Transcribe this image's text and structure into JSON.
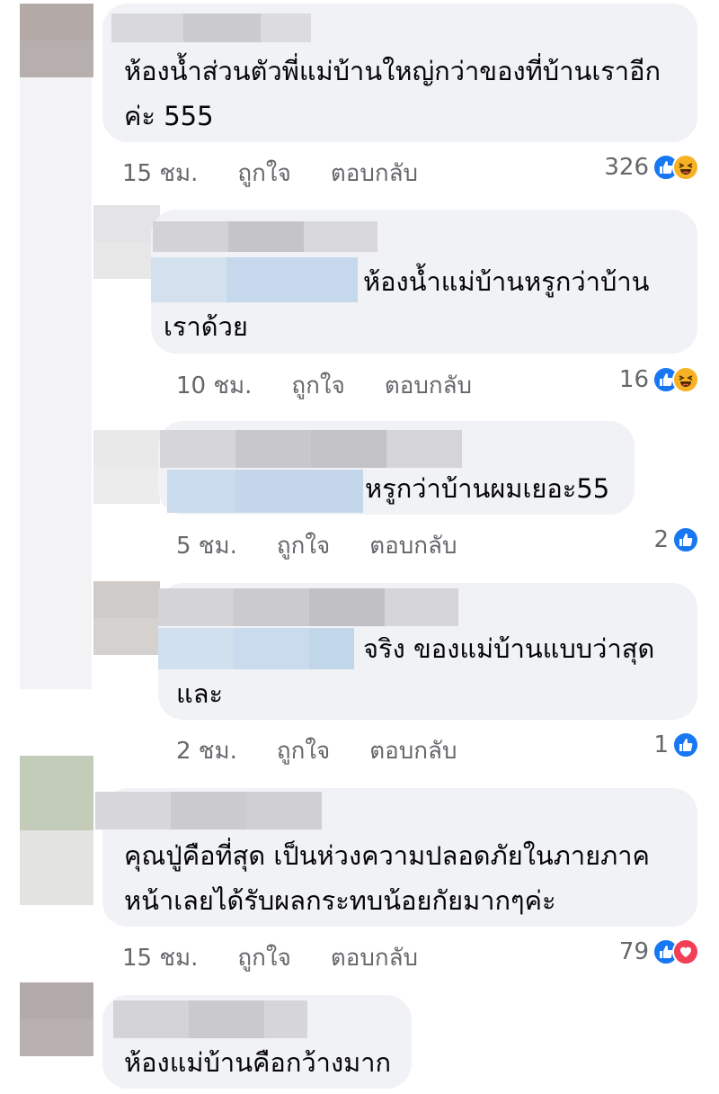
{
  "colors": {
    "bubble": "#f0f2f5",
    "like_blue": "#1877f2",
    "haha_yellow": "#f7b125",
    "love_red": "#f33e58",
    "meta_gray": "#65676b",
    "name_blur": [
      "#d6d6da",
      "#c9c9cd",
      "#dadadd"
    ],
    "mention_blur": [
      "#d3e1ee",
      "#cadbea",
      "#c3d6ea"
    ]
  },
  "comments": [
    {
      "lines": [
        "ห้องน้ำส่วนตัวพี่แม่บ้านใหญ่กว่าของที่บ้านเราอีก",
        "ค่ะ 555"
      ],
      "time": "15 ชม.",
      "like": "ถูกใจ",
      "reply": "ตอบกลับ",
      "reaction_count": "326",
      "reaction_icons": [
        "like-icon",
        "haha-icon"
      ]
    },
    {
      "lines": [
        "ห้องน้ำแม่บ้านหรูกว่าบ้าน",
        "เราด้วย"
      ],
      "time": "10 ชม.",
      "like": "ถูกใจ",
      "reply": "ตอบกลับ",
      "reaction_count": "16",
      "reaction_icons": [
        "like-icon",
        "haha-icon"
      ]
    },
    {
      "lines": [
        "หรูกว่าบ้านผมเยอะ55"
      ],
      "time": "5 ชม.",
      "like": "ถูกใจ",
      "reply": "ตอบกลับ",
      "reaction_count": "2",
      "reaction_icons": [
        "like-icon"
      ]
    },
    {
      "lines": [
        "จริง ของแม่บ้านแบบว่าสุด",
        "และ"
      ],
      "time": "2 ชม.",
      "like": "ถูกใจ",
      "reply": "ตอบกลับ",
      "reaction_count": "1",
      "reaction_icons": [
        "like-icon"
      ]
    },
    {
      "lines": [
        "คุณปู่คือที่สุด เป็นห่วงความปลอดภัยในภายภาค",
        "หน้าเลยได้รับผลกระทบน้อยกัยมากๆค่ะ"
      ],
      "time": "15 ชม.",
      "like": "ถูกใจ",
      "reply": "ตอบกลับ",
      "reaction_count": "79",
      "reaction_icons": [
        "like-icon",
        "love-icon"
      ]
    },
    {
      "lines": [
        "ห้องแม่บ้านคือกว้างมาก"
      ]
    }
  ]
}
